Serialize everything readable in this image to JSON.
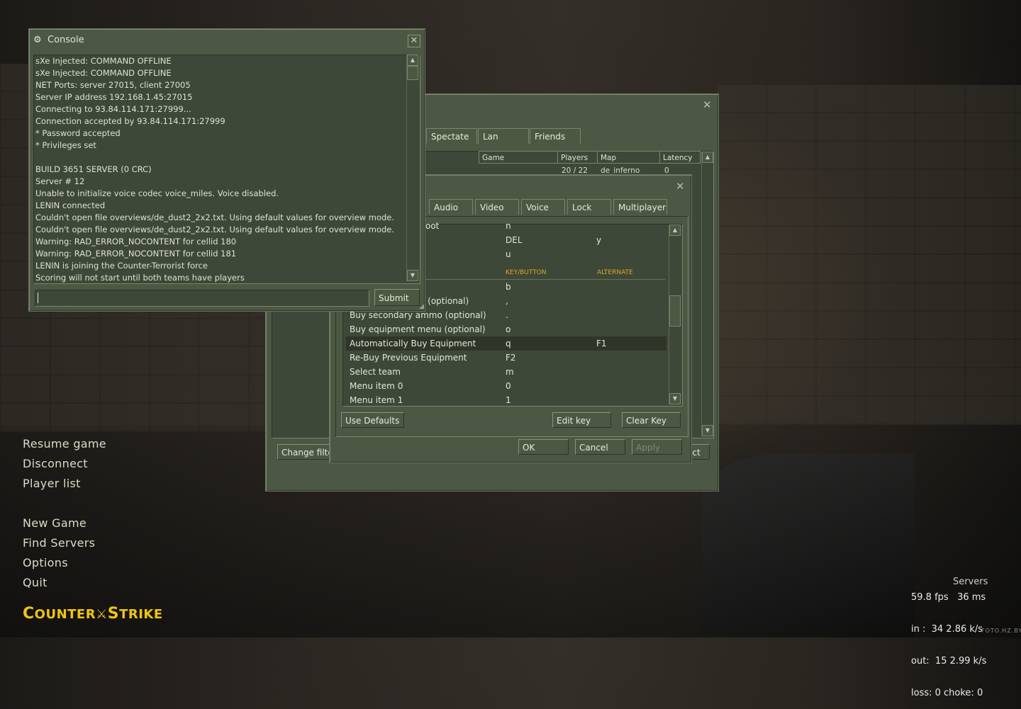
{
  "console": {
    "title": "Console",
    "lines": [
      "sXe Injected: COMMAND OFFLINE",
      "sXe Injected: COMMAND OFFLINE",
      "NET Ports:  server 27015, client 27005",
      "Server IP address 192.168.1.45:27015",
      "Connecting to 93.84.114.171:27999...",
      "Connection accepted by 93.84.114.171:27999",
      "* Password accepted",
      "* Privileges set",
      "",
      "BUILD 3651 SERVER (0 CRC)",
      "Server # 12",
      "Unable to initialize voice codec voice_miles.  Voice disabled.",
      "LENIN connected",
      "Couldn't open file overviews/de_dust2_2x2.txt. Using default values for overview mode.",
      "Couldn't open file overviews/de_dust2_2x2.txt. Using default values for overview mode.",
      "Warning:  RAD_ERROR_NOCONTENT for cellid 180",
      "Warning:  RAD_ERROR_NOCONTENT for cellid 181",
      "LENIN is joining the Counter-Terrorist force",
      "Scoring will not start until both teams have players"
    ],
    "input_value": "",
    "submit_label": "Submit"
  },
  "servers": {
    "tabs": [
      "Spectate",
      "Lan",
      "Friends"
    ],
    "columns": [
      "Game",
      "Players",
      "Map",
      "Latency"
    ],
    "row": {
      "players": "20 / 22",
      "map": "de_inferno",
      "latency": "0"
    },
    "change_filter_label": "Change filte",
    "connect_partial": "ect"
  },
  "options": {
    "tabs": [
      "Audio",
      "Video",
      "Voice",
      "Lock",
      "Multiplayer"
    ],
    "header_key": "KEY/BUTTON",
    "header_alt": "ALTERNATE",
    "top_rows": [
      {
        "action": "oot",
        "key": "n",
        "alt": ""
      },
      {
        "action": "",
        "key": "DEL",
        "alt": "y"
      },
      {
        "action": "",
        "key": "u",
        "alt": ""
      }
    ],
    "rows": [
      {
        "action": "",
        "key": "b",
        "alt": ""
      },
      {
        "action": "o (optional)",
        "key": ",",
        "alt": ""
      },
      {
        "action": "Buy secondary ammo (optional)",
        "key": ".",
        "alt": ""
      },
      {
        "action": "Buy equipment menu (optional)",
        "key": "o",
        "alt": ""
      },
      {
        "action": "Automatically Buy Equipment",
        "key": "q",
        "alt": "F1"
      },
      {
        "action": "Re-Buy Previous Equipment",
        "key": "F2",
        "alt": ""
      },
      {
        "action": "Select team",
        "key": "m",
        "alt": ""
      },
      {
        "action": "Menu item 0",
        "key": "0",
        "alt": ""
      },
      {
        "action": "Menu item 1",
        "key": "1",
        "alt": ""
      }
    ],
    "use_defaults": "Use Defaults",
    "edit_key": "Edit key",
    "clear_key": "Clear Key",
    "ok": "OK",
    "cancel": "Cancel",
    "apply": "Apply"
  },
  "main_menu": {
    "group1": [
      "Resume game",
      "Disconnect",
      "Player list"
    ],
    "group2": [
      "New Game",
      "Find Servers",
      "Options",
      "Quit"
    ]
  },
  "logo": {
    "part1_big": "C",
    "part1": "OUNTER",
    "part2_big": "S",
    "part2": "TRIKE"
  },
  "netgraph": {
    "line1": "59.8 fps   36 ms",
    "line2": "in :  34 2.86 k/s",
    "line3": "out:  15 2.99 k/s",
    "line4": "loss: 0 choke: 0",
    "ghost": "Servers"
  },
  "watermark": "FOTO.HZ.BY"
}
